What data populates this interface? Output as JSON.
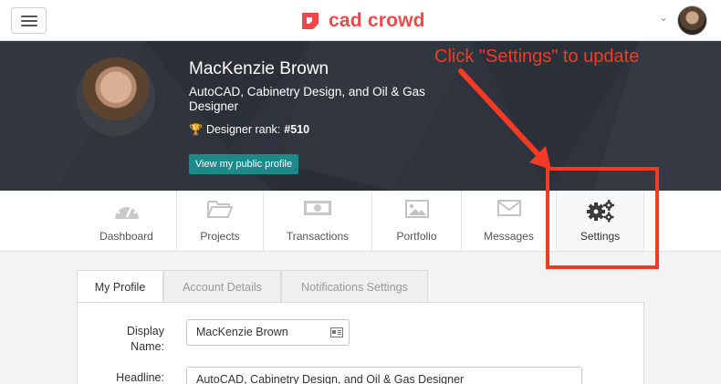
{
  "header": {
    "logo_text": "cad crowd",
    "brand_color": "#ea4a4a"
  },
  "profile": {
    "name": "MacKenzie Brown",
    "headline": "AutoCAD, Cabinetry Design, and Oil & Gas Designer",
    "rank_label": "Designer rank:",
    "rank_value": "#510",
    "public_profile_button": "View my public profile"
  },
  "annotation": {
    "text": "Click \"Settings\" to update",
    "color": "#f23a24"
  },
  "nav": {
    "items": [
      {
        "label": "Dashboard",
        "icon": "dashboard-icon"
      },
      {
        "label": "Projects",
        "icon": "folder-icon"
      },
      {
        "label": "Transactions",
        "icon": "money-icon"
      },
      {
        "label": "Portfolio",
        "icon": "image-icon"
      },
      {
        "label": "Messages",
        "icon": "envelope-icon"
      },
      {
        "label": "Settings",
        "icon": "gears-icon",
        "active": true
      }
    ]
  },
  "settings": {
    "tabs": [
      {
        "label": "My Profile",
        "active": true
      },
      {
        "label": "Account Details"
      },
      {
        "label": "Notifications Settings"
      }
    ],
    "fields": {
      "display_name_label_1": "Display",
      "display_name_label_2": "Name:",
      "display_name_value": "MacKenzie Brown",
      "headline_label": "Headline:",
      "headline_value": "AutoCAD, Cabinetry Design, and Oil & Gas Designer"
    }
  }
}
